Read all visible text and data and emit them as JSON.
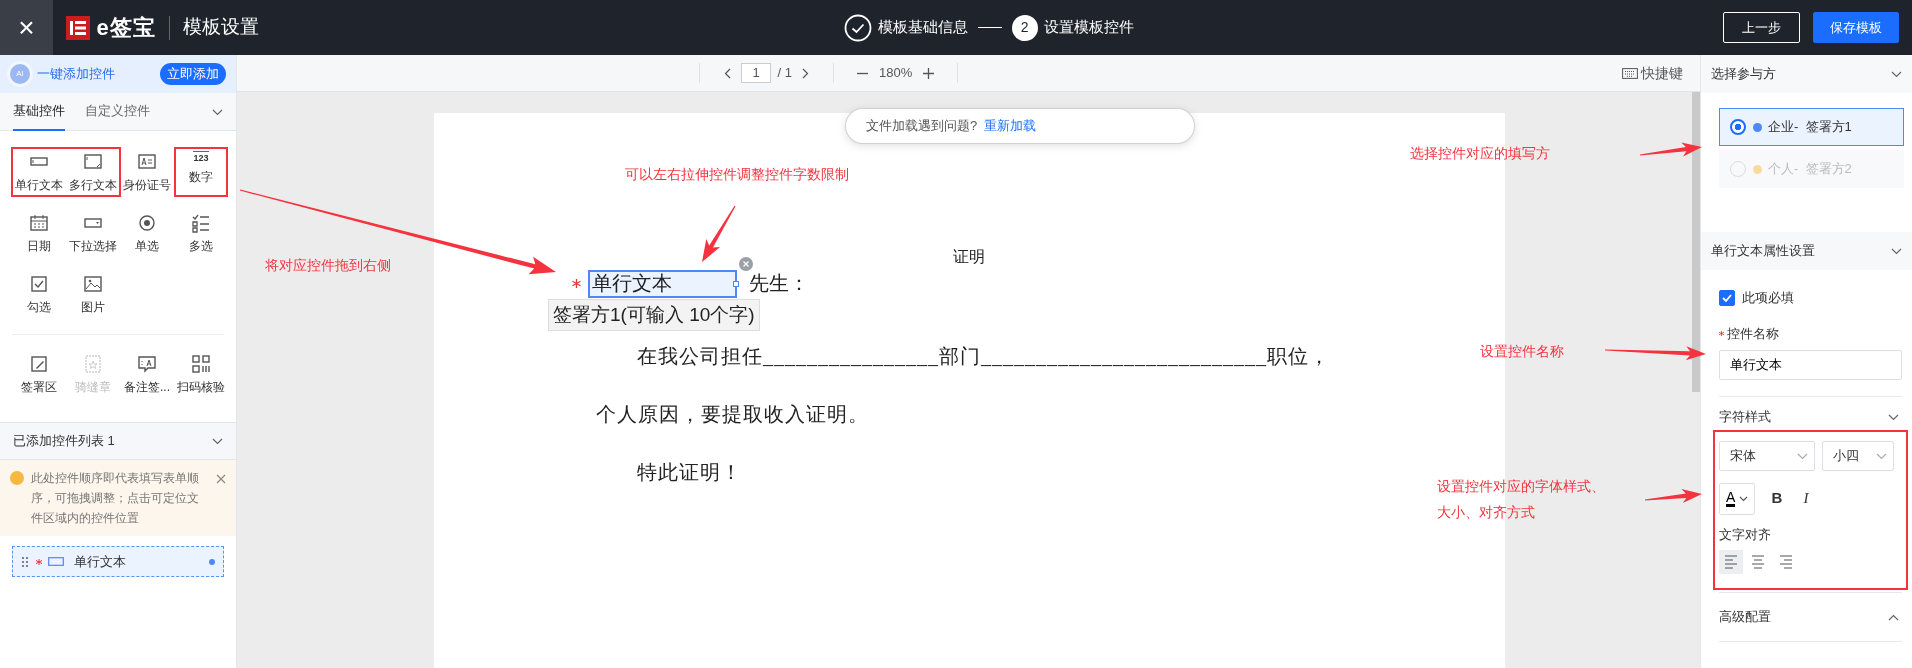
{
  "topbar": {
    "close_glyph": "×",
    "logo_text": "e签宝",
    "title": "模板设置",
    "steps": [
      {
        "label": "模板基础信息",
        "done": true
      },
      {
        "label": "设置模板控件",
        "done": false,
        "number": "2"
      }
    ],
    "buttons": [
      {
        "label": "上一步",
        "kind": "outline"
      },
      {
        "label": "保存模板",
        "kind": "primary"
      }
    ]
  },
  "left_panel": {
    "ai_banner": {
      "badge": "AI",
      "text": "一键添加控件",
      "button": "立即添加"
    },
    "tabs": [
      {
        "label": "基础控件",
        "selected": true
      },
      {
        "label": "自定义控件",
        "selected": false
      }
    ],
    "control_groups": [
      {
        "items": [
          {
            "label": "单行文本",
            "kind": "single-line",
            "disabled": false
          },
          {
            "label": "多行文本",
            "kind": "multi-line",
            "disabled": false
          },
          {
            "label": "身份证号",
            "kind": "id",
            "disabled": false
          },
          {
            "label": "数字",
            "kind": "number",
            "glyph": "123",
            "disabled": false
          },
          {
            "label": "日期",
            "kind": "date",
            "disabled": false
          },
          {
            "label": "下拉选择",
            "kind": "select",
            "disabled": false
          },
          {
            "label": "单选",
            "kind": "radio",
            "disabled": false
          },
          {
            "label": "多选",
            "kind": "multi-select",
            "disabled": false
          },
          {
            "label": "勾选",
            "kind": "check",
            "disabled": false
          },
          {
            "label": "图片",
            "kind": "image",
            "disabled": false
          }
        ]
      },
      {
        "items": [
          {
            "label": "签署区",
            "kind": "sign",
            "disabled": false
          },
          {
            "label": "骑缝章",
            "kind": "seal",
            "disabled": true
          },
          {
            "label": "备注签...",
            "kind": "note",
            "disabled": false
          },
          {
            "label": "扫码核验",
            "kind": "scan",
            "disabled": false
          }
        ]
      }
    ],
    "added_list": {
      "title": "已添加控件列表 1",
      "notice": "此处控件顺序即代表填写表单顺序，可拖拽调整；点击可定位文件区域内的控件位置",
      "items": [
        {
          "label": "单行文本",
          "required": true,
          "color": "#4d88f5"
        }
      ]
    }
  },
  "toolbar": {
    "page": "1",
    "page_total": "/ 1",
    "zoom": "180%",
    "shortcut": "快捷键"
  },
  "document": {
    "notice": {
      "text": "文件加载遇到问题?",
      "link": "重新加载"
    },
    "title": "证明",
    "field": {
      "value": "单行文本",
      "required": true,
      "after": "先生：",
      "tooltip": "签署方1(可输入 10个字)"
    },
    "paragraphs": [
      {
        "text": "在我公司担任________________部门__________________________职位，",
        "indent": true
      },
      {
        "text": "个人原因，要提取收入证明。",
        "indent": false
      },
      {
        "text": "特此证明！",
        "indent": true
      }
    ]
  },
  "right_panel": {
    "participants": {
      "title": "选择参与方",
      "options": [
        {
          "label": "企业-  签署方1",
          "selected": true,
          "disabled": false,
          "color": "#4d88f5"
        },
        {
          "label": "个人-  签署方2",
          "selected": false,
          "disabled": true,
          "color": "#f8d9a0"
        }
      ]
    },
    "properties": {
      "title": "单行文本属性设置",
      "required": {
        "label": "此项必填",
        "checked": true
      },
      "name_label": "控件名称",
      "name_value": "单行文本",
      "style_title": "字符样式",
      "font": "宋体",
      "size": "小四",
      "color_glyph": "A",
      "bold": "B",
      "italic": "I",
      "align_label": "文字对齐",
      "align": [
        {
          "kind": "left",
          "selected": true
        },
        {
          "kind": "center",
          "selected": false
        },
        {
          "kind": "right",
          "selected": false
        }
      ]
    },
    "advanced": {
      "title": "高级配置",
      "expanded": true
    }
  },
  "annotations": [
    {
      "text": "将对应控件拖到右侧"
    },
    {
      "text": "可以左右拉伸控件调整控件字数限制"
    },
    {
      "text": "选择控件对应的填写方"
    },
    {
      "text": "设置控件名称"
    },
    {
      "text": "设置控件对应的字体样式、大小、对齐方式"
    }
  ]
}
